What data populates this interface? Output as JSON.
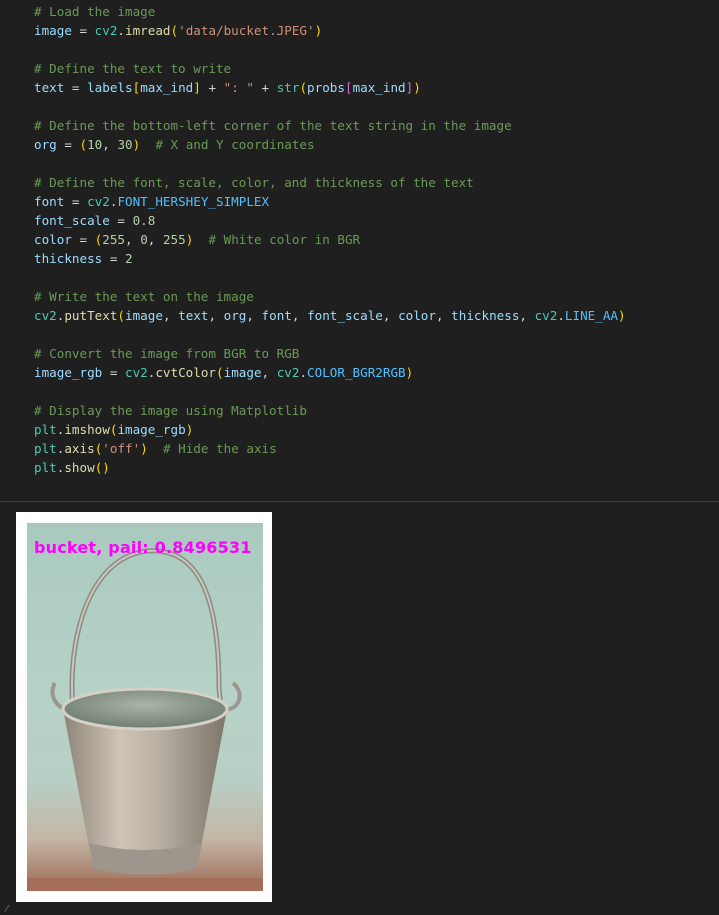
{
  "code_lines": [
    {
      "parts": [
        {
          "t": "# Load the image",
          "c": "cm"
        }
      ]
    },
    {
      "parts": [
        {
          "t": "image",
          "c": "v"
        },
        {
          "t": " = ",
          "c": "o"
        },
        {
          "t": "cv2",
          "c": "c"
        },
        {
          "t": ".",
          "c": "o"
        },
        {
          "t": "imread",
          "c": "f"
        },
        {
          "t": "(",
          "c": "p1"
        },
        {
          "t": "'data/bucket.JPEG'",
          "c": "s"
        },
        {
          "t": ")",
          "c": "p1"
        }
      ]
    },
    {
      "parts": []
    },
    {
      "parts": [
        {
          "t": "# Define the text to write",
          "c": "cm"
        }
      ]
    },
    {
      "parts": [
        {
          "t": "text",
          "c": "v"
        },
        {
          "t": " = ",
          "c": "o"
        },
        {
          "t": "labels",
          "c": "v"
        },
        {
          "t": "[",
          "c": "p1"
        },
        {
          "t": "max_ind",
          "c": "v"
        },
        {
          "t": "]",
          "c": "p1"
        },
        {
          "t": " + ",
          "c": "o"
        },
        {
          "t": "\": \"",
          "c": "s"
        },
        {
          "t": " + ",
          "c": "o"
        },
        {
          "t": "str",
          "c": "c"
        },
        {
          "t": "(",
          "c": "p1"
        },
        {
          "t": "probs",
          "c": "v"
        },
        {
          "t": "[",
          "c": "p2"
        },
        {
          "t": "max_ind",
          "c": "v"
        },
        {
          "t": "]",
          "c": "p2"
        },
        {
          "t": ")",
          "c": "p1"
        }
      ]
    },
    {
      "parts": []
    },
    {
      "parts": [
        {
          "t": "# Define the bottom-left corner of the text string in the image",
          "c": "cm"
        }
      ]
    },
    {
      "parts": [
        {
          "t": "org",
          "c": "v"
        },
        {
          "t": " = ",
          "c": "o"
        },
        {
          "t": "(",
          "c": "p1"
        },
        {
          "t": "10",
          "c": "n"
        },
        {
          "t": ", ",
          "c": "o"
        },
        {
          "t": "30",
          "c": "n"
        },
        {
          "t": ")",
          "c": "p1"
        },
        {
          "t": "  ",
          "c": "o"
        },
        {
          "t": "# X and Y coordinates",
          "c": "cm"
        }
      ]
    },
    {
      "parts": []
    },
    {
      "parts": [
        {
          "t": "# Define the font, scale, color, and thickness of the text",
          "c": "cm"
        }
      ]
    },
    {
      "parts": [
        {
          "t": "font",
          "c": "v"
        },
        {
          "t": " = ",
          "c": "o"
        },
        {
          "t": "cv2",
          "c": "c"
        },
        {
          "t": ".",
          "c": "o"
        },
        {
          "t": "FONT_HERSHEY_SIMPLEX",
          "c": "cst"
        }
      ]
    },
    {
      "parts": [
        {
          "t": "font_scale",
          "c": "v"
        },
        {
          "t": " = ",
          "c": "o"
        },
        {
          "t": "0.8",
          "c": "n"
        }
      ]
    },
    {
      "parts": [
        {
          "t": "color",
          "c": "v"
        },
        {
          "t": " = ",
          "c": "o"
        },
        {
          "t": "(",
          "c": "p1"
        },
        {
          "t": "255",
          "c": "n"
        },
        {
          "t": ", ",
          "c": "o"
        },
        {
          "t": "0",
          "c": "n"
        },
        {
          "t": ", ",
          "c": "o"
        },
        {
          "t": "255",
          "c": "n"
        },
        {
          "t": ")",
          "c": "p1"
        },
        {
          "t": "  ",
          "c": "o"
        },
        {
          "t": "# White color in BGR",
          "c": "cm"
        }
      ]
    },
    {
      "parts": [
        {
          "t": "thickness",
          "c": "v"
        },
        {
          "t": " = ",
          "c": "o"
        },
        {
          "t": "2",
          "c": "n"
        }
      ]
    },
    {
      "parts": []
    },
    {
      "parts": [
        {
          "t": "# Write the text on the image",
          "c": "cm"
        }
      ]
    },
    {
      "parts": [
        {
          "t": "cv2",
          "c": "c"
        },
        {
          "t": ".",
          "c": "o"
        },
        {
          "t": "putText",
          "c": "f"
        },
        {
          "t": "(",
          "c": "p1"
        },
        {
          "t": "image",
          "c": "v"
        },
        {
          "t": ", ",
          "c": "o"
        },
        {
          "t": "text",
          "c": "v"
        },
        {
          "t": ", ",
          "c": "o"
        },
        {
          "t": "org",
          "c": "v"
        },
        {
          "t": ", ",
          "c": "o"
        },
        {
          "t": "font",
          "c": "v"
        },
        {
          "t": ", ",
          "c": "o"
        },
        {
          "t": "font_scale",
          "c": "v"
        },
        {
          "t": ", ",
          "c": "o"
        },
        {
          "t": "color",
          "c": "v"
        },
        {
          "t": ", ",
          "c": "o"
        },
        {
          "t": "thickness",
          "c": "v"
        },
        {
          "t": ", ",
          "c": "o"
        },
        {
          "t": "cv2",
          "c": "c"
        },
        {
          "t": ".",
          "c": "o"
        },
        {
          "t": "LINE_AA",
          "c": "cst"
        },
        {
          "t": ")",
          "c": "p1"
        }
      ]
    },
    {
      "parts": []
    },
    {
      "parts": [
        {
          "t": "# Convert the image from BGR to RGB",
          "c": "cm"
        }
      ]
    },
    {
      "parts": [
        {
          "t": "image_rgb",
          "c": "v"
        },
        {
          "t": " = ",
          "c": "o"
        },
        {
          "t": "cv2",
          "c": "c"
        },
        {
          "t": ".",
          "c": "o"
        },
        {
          "t": "cvtColor",
          "c": "f"
        },
        {
          "t": "(",
          "c": "p1"
        },
        {
          "t": "image",
          "c": "v"
        },
        {
          "t": ", ",
          "c": "o"
        },
        {
          "t": "cv2",
          "c": "c"
        },
        {
          "t": ".",
          "c": "o"
        },
        {
          "t": "COLOR_BGR2RGB",
          "c": "cst"
        },
        {
          "t": ")",
          "c": "p1"
        }
      ]
    },
    {
      "parts": []
    },
    {
      "parts": [
        {
          "t": "# Display the image using Matplotlib",
          "c": "cm"
        }
      ]
    },
    {
      "parts": [
        {
          "t": "plt",
          "c": "c"
        },
        {
          "t": ".",
          "c": "o"
        },
        {
          "t": "imshow",
          "c": "f"
        },
        {
          "t": "(",
          "c": "p1"
        },
        {
          "t": "image_rgb",
          "c": "v"
        },
        {
          "t": ")",
          "c": "p1"
        }
      ]
    },
    {
      "parts": [
        {
          "t": "plt",
          "c": "c"
        },
        {
          "t": ".",
          "c": "o"
        },
        {
          "t": "axis",
          "c": "f"
        },
        {
          "t": "(",
          "c": "p1"
        },
        {
          "t": "'off'",
          "c": "s"
        },
        {
          "t": ")",
          "c": "p1"
        },
        {
          "t": "  ",
          "c": "o"
        },
        {
          "t": "# Hide the axis",
          "c": "cm"
        }
      ]
    },
    {
      "parts": [
        {
          "t": "plt",
          "c": "c"
        },
        {
          "t": ".",
          "c": "o"
        },
        {
          "t": "show",
          "c": "f"
        },
        {
          "t": "(",
          "c": "p1"
        },
        {
          "t": ")",
          "c": "p1"
        }
      ]
    }
  ],
  "output": {
    "overlay_text": "bucket, pail: 0.8496531",
    "overlay_color": "#ff00ff",
    "image_subject": "metal-bucket-photo"
  },
  "colors": {
    "background": "#1f1f1f",
    "comment": "#6a9955",
    "variable": "#9cdcfe",
    "function": "#dcdcaa",
    "string": "#ce9178",
    "number": "#b5cea8"
  }
}
